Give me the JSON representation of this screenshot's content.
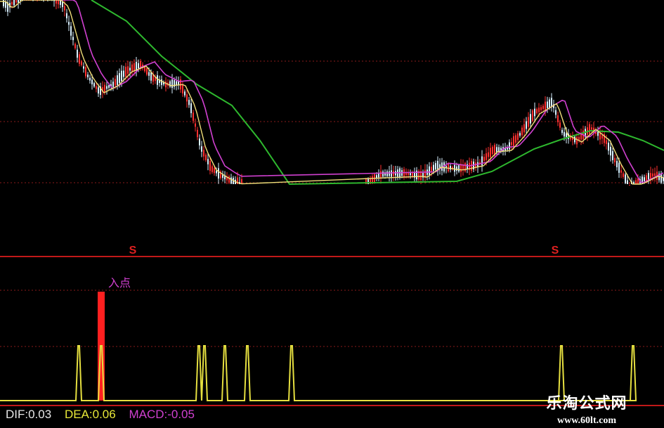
{
  "colors": {
    "background": "#000000",
    "grid": "#8a1a1a",
    "separator": "#c01818",
    "candle_up": "#ff3030",
    "candle_down": "#d8f0ff",
    "ma_short": "#f2e07a",
    "ma_mid": "#d040d0",
    "ma_long": "#2eb82e",
    "signal_line": "#e6e040",
    "signal_bar": "#ff2020",
    "label_text": "#d040d0"
  },
  "sell_marks": [
    "S",
    "S"
  ],
  "signal_label": "入点",
  "indicator": {
    "dif": "DIF:0.03",
    "dea": "DEA:0.06",
    "macd": "MACD:-0.05"
  },
  "watermark": {
    "title": "乐淘公式网",
    "url": "www.60lt.com"
  }
}
